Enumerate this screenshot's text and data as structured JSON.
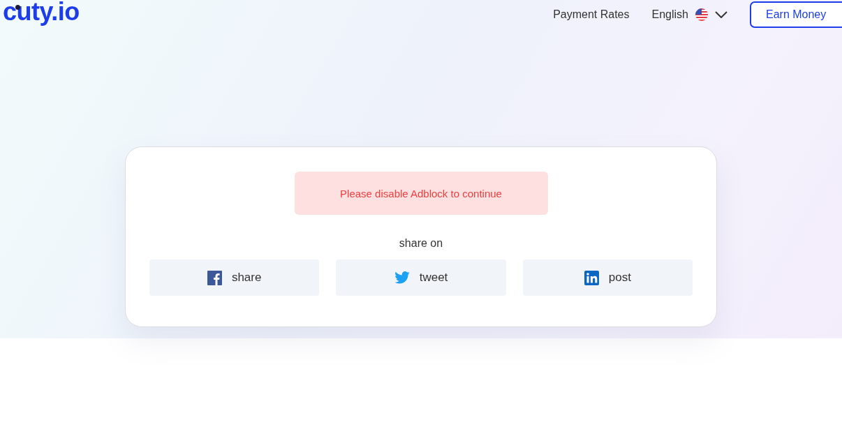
{
  "header": {
    "logo": "cuty.io",
    "nav": [
      {
        "label": "Payment Rates"
      }
    ],
    "language": {
      "label": "English"
    },
    "cta": "Earn Money"
  },
  "card": {
    "alert": "Please disable Adblock to continue",
    "share_title": "share on",
    "share_buttons": [
      {
        "kind": "facebook",
        "label": "share"
      },
      {
        "kind": "twitter",
        "label": "tweet"
      },
      {
        "kind": "linkedin",
        "label": "post"
      }
    ]
  }
}
